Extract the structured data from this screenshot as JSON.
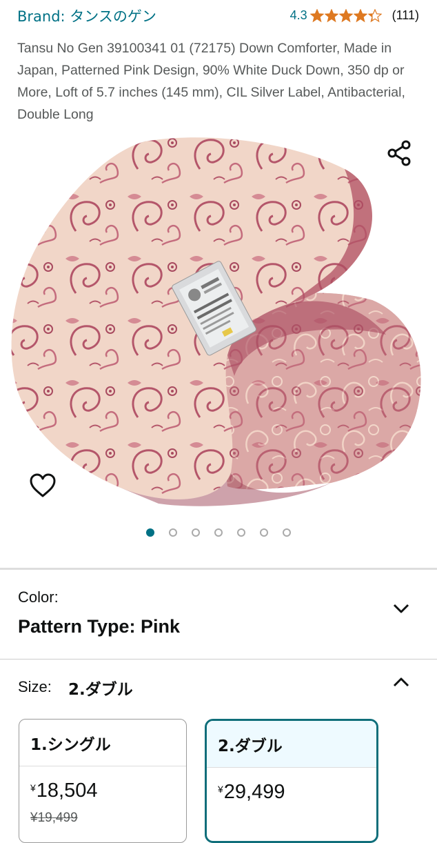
{
  "brand": {
    "label": "Brand: タンスのゲン"
  },
  "rating": {
    "value": "4.3",
    "stars": 4.3,
    "count": "(111)",
    "star_color": "#de7921"
  },
  "product": {
    "title": "Tansu No Gen 39100341 01 (72175) Down Comforter, Made in Japan, Patterned Pink Design, 90% White Duck Down, 350 dp or More, Loft of 5.7 inches (145 mm), CIL Silver Label, Antibacterial, Double Long"
  },
  "gallery": {
    "image_count": 7,
    "active_index": 0,
    "tag_text": "Guarantee Label"
  },
  "color": {
    "label": "Color:",
    "value": "Pattern Type: Pink"
  },
  "size": {
    "label": "Size:",
    "value": "2.ダブル",
    "options": [
      {
        "name": "1.シングル",
        "price": "18,504",
        "currency": "¥",
        "list_price": "¥19,499",
        "selected": false
      },
      {
        "name": "2.ダブル",
        "price": "29,499",
        "currency": "¥",
        "list_price": "",
        "selected": true
      }
    ]
  },
  "colors": {
    "link": "#007185",
    "accent": "#0f6e7a",
    "fabric_base": "#f3dccf",
    "fabric_pattern": "#b4566a"
  }
}
